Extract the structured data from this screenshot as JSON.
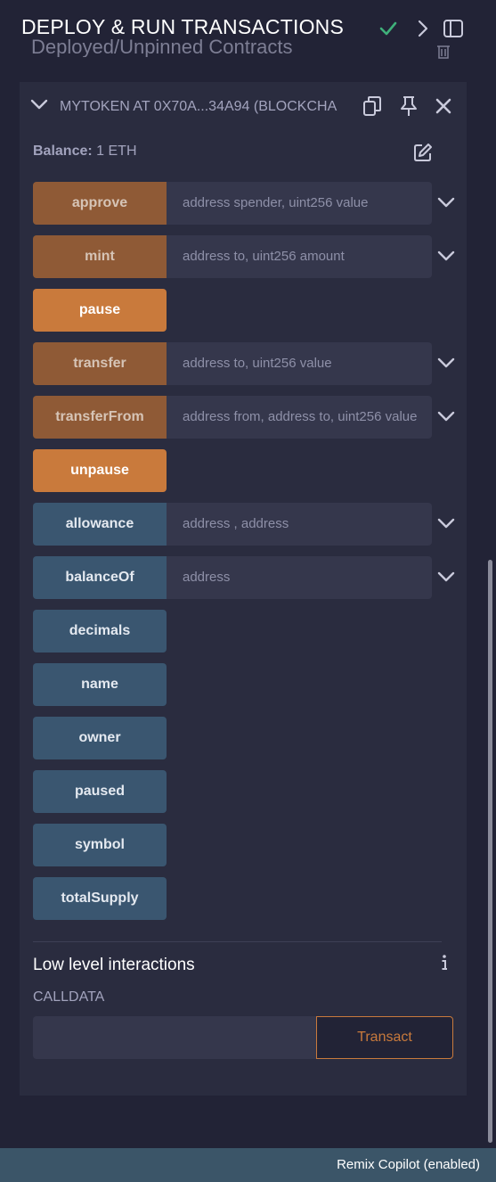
{
  "header": {
    "title": "DEPLOY & RUN TRANSACTIONS",
    "section_title_partial": "Deployed/Unpinned Contracts"
  },
  "contract": {
    "name": "MYTOKEN AT 0X70A...34A94 (BLOCKCHA",
    "balance_label": "Balance:",
    "balance_value": "1 ETH"
  },
  "functions": [
    {
      "label": "approve",
      "kind": "transact",
      "placeholder": "address spender, uint256 value"
    },
    {
      "label": "mint",
      "kind": "transact",
      "placeholder": "address to, uint256 amount"
    },
    {
      "label": "pause",
      "kind": "payable-solo",
      "placeholder": ""
    },
    {
      "label": "transfer",
      "kind": "transact",
      "placeholder": "address to, uint256 value"
    },
    {
      "label": "transferFrom",
      "kind": "transact",
      "placeholder": "address from, address to, uint256 value"
    },
    {
      "label": "unpause",
      "kind": "payable-solo",
      "placeholder": ""
    },
    {
      "label": "allowance",
      "kind": "call",
      "placeholder": "address , address"
    },
    {
      "label": "balanceOf",
      "kind": "call",
      "placeholder": "address"
    },
    {
      "label": "decimals",
      "kind": "call-solo",
      "placeholder": ""
    },
    {
      "label": "name",
      "kind": "call-solo",
      "placeholder": ""
    },
    {
      "label": "owner",
      "kind": "call-solo",
      "placeholder": ""
    },
    {
      "label": "paused",
      "kind": "call-solo",
      "placeholder": ""
    },
    {
      "label": "symbol",
      "kind": "call-solo",
      "placeholder": ""
    },
    {
      "label": "totalSupply",
      "kind": "call-solo",
      "placeholder": ""
    }
  ],
  "low_level": {
    "title": "Low level interactions",
    "calldata_label": "CALLDATA",
    "transact_label": "Transact"
  },
  "footer": {
    "status": "Remix Copilot (enabled)"
  },
  "colors": {
    "background": "#222336",
    "card": "#2a2c3f",
    "transact_button": "#8f5a36",
    "payable_button": "#c97a3c",
    "call_button": "#3a5670",
    "success_check": "#3fb07a",
    "footer": "#3b5568"
  }
}
